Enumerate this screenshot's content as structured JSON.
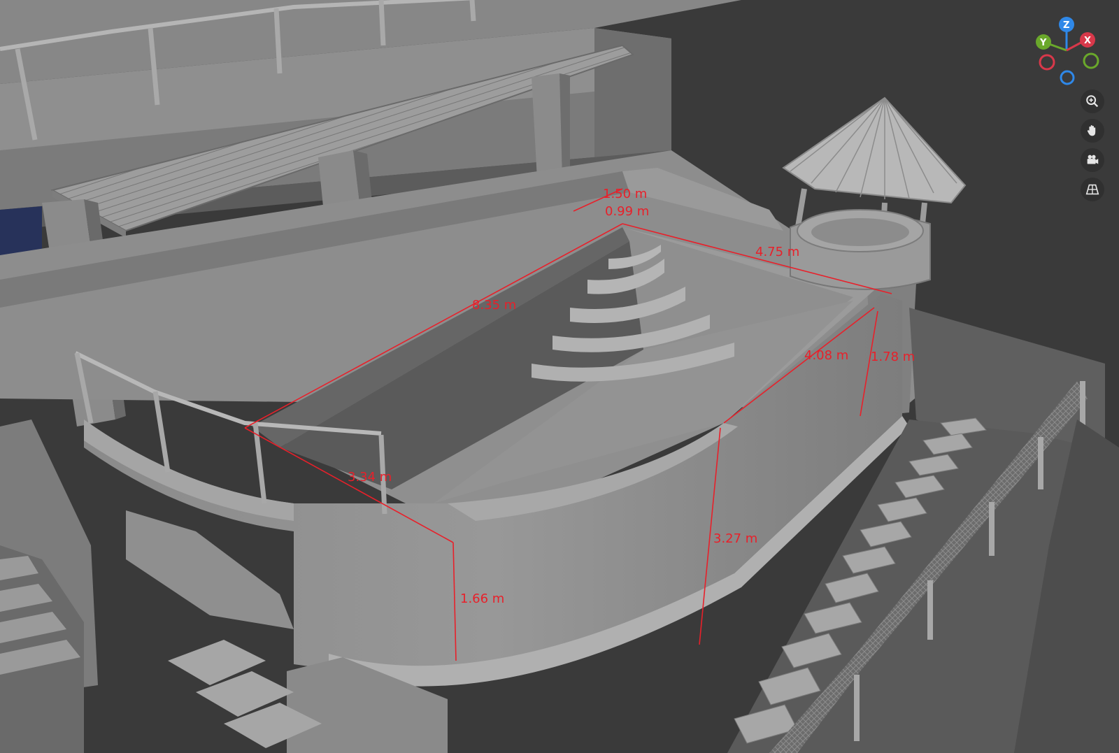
{
  "viewport": {
    "background": "#3a3a3a",
    "measure_color": "#e8202a"
  },
  "measurements": [
    {
      "id": "m-top-1",
      "text": "1.50 m"
    },
    {
      "id": "m-top-2",
      "text": "0.99 m"
    },
    {
      "id": "m-tower",
      "text": "4.75 m"
    },
    {
      "id": "m-pool-length",
      "text": "8.35 m"
    },
    {
      "id": "m-right-wall",
      "text": "4.08 m"
    },
    {
      "id": "m-right-height",
      "text": "1.78 m"
    },
    {
      "id": "m-front",
      "text": "3.34 m"
    },
    {
      "id": "m-drop",
      "text": "1.66 m"
    },
    {
      "id": "m-wall-height",
      "text": "3.27 m"
    }
  ],
  "gizmo": {
    "axes": [
      {
        "label": "Z",
        "color": "#2f88e8"
      },
      {
        "label": "Y",
        "color": "#6aa82b"
      },
      {
        "label": "X",
        "color": "#d8384a"
      }
    ],
    "negative_colors": [
      "#d8384a",
      "#6aa82b",
      "#2f88e8"
    ]
  },
  "navigation": [
    {
      "id": "zoom",
      "icon": "zoom-icon",
      "tooltip": ""
    },
    {
      "id": "pan",
      "icon": "hand-icon",
      "tooltip": ""
    },
    {
      "id": "camera",
      "icon": "camera-icon",
      "tooltip": ""
    },
    {
      "id": "perspective",
      "icon": "grid-icon",
      "tooltip": ""
    }
  ]
}
